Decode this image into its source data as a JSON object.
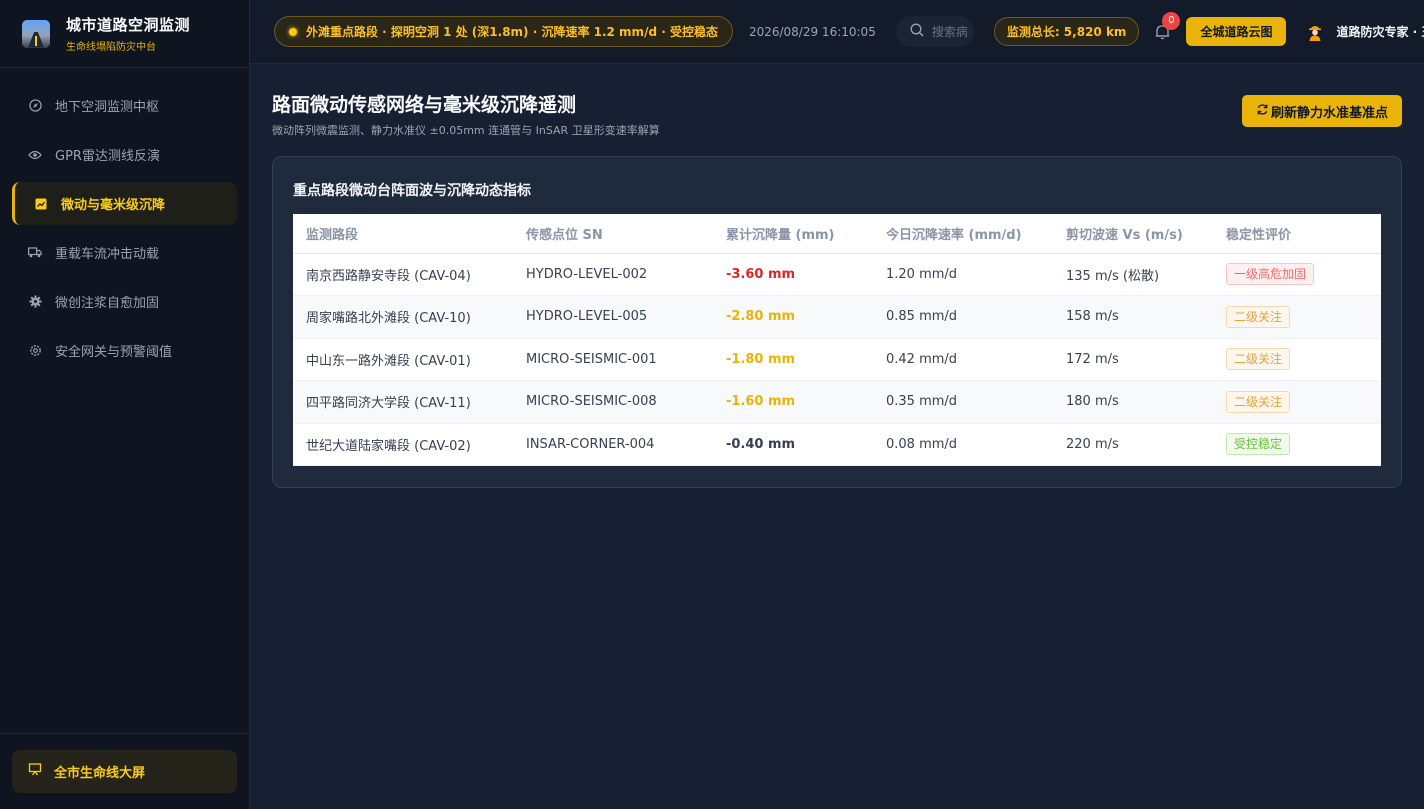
{
  "brand": {
    "title": "城市道路空洞监测",
    "subtitle": "生命线塌陷防灾中台"
  },
  "sidebar": {
    "items": [
      {
        "label": "地下空洞监测中枢",
        "icon": "compass-icon"
      },
      {
        "label": "GPR雷达测线反演",
        "icon": "eye-icon"
      },
      {
        "label": "微动与毫米级沉降",
        "icon": "chart-icon",
        "active": true
      },
      {
        "label": "重载车流冲击动载",
        "icon": "truck-icon"
      },
      {
        "label": "微创注浆自愈加固",
        "icon": "gear-icon"
      },
      {
        "label": "安全网关与预警阈值",
        "icon": "settings-icon"
      }
    ],
    "bottom_button": "全市生命线大屏"
  },
  "header": {
    "alert": "外滩重点路段 · 探明空洞 1 处 (深1.8m) · 沉降速率 1.2 mm/d · 受控稳态",
    "datetime": "2026/08/29 16:10:05",
    "search_placeholder": "搜索病",
    "length": "监测总长: 5,820 km",
    "notifications": "0",
    "map_button": "全城道路云图",
    "user": "道路防灾专家 · 王总工"
  },
  "page": {
    "title": "路面微动传感网络与毫米级沉降遥测",
    "subtitle": "微动阵列微震监测、静力水准仪 ±0.05mm 连通管与 InSAR 卫星形变速率解算",
    "refresh_button": "刷新静力水准基准点"
  },
  "card": {
    "title": "重点路段微动台阵面波与沉降动态指标",
    "columns": [
      "监测路段",
      "传感点位 SN",
      "累计沉降量 (mm)",
      "今日沉降速率 (mm/d)",
      "剪切波速 Vs (m/s)",
      "稳定性评价"
    ],
    "rows": [
      {
        "section": "南京西路静安寺段 (CAV-04)",
        "sn": "HYDRO-LEVEL-002",
        "settle": "-3.60 mm",
        "rate": "1.20 mm/d",
        "vs": "135 m/s (松散)",
        "eval": "一级高危加固"
      },
      {
        "section": "周家嘴路北外滩段 (CAV-10)",
        "sn": "HYDRO-LEVEL-005",
        "settle": "-2.80 mm",
        "rate": "0.85 mm/d",
        "vs": "158 m/s",
        "eval": "二级关注"
      },
      {
        "section": "中山东一路外滩段 (CAV-01)",
        "sn": "MICRO-SEISMIC-001",
        "settle": "-1.80 mm",
        "rate": "0.42 mm/d",
        "vs": "172 m/s",
        "eval": "二级关注"
      },
      {
        "section": "四平路同济大学段 (CAV-11)",
        "sn": "MICRO-SEISMIC-008",
        "settle": "-1.60 mm",
        "rate": "0.35 mm/d",
        "vs": "180 m/s",
        "eval": "二级关注"
      },
      {
        "section": "世纪大道陆家嘴段 (CAV-02)",
        "sn": "INSAR-CORNER-004",
        "settle": "-0.40 mm",
        "rate": "0.08 mm/d",
        "vs": "220 m/s",
        "eval": "受控稳定"
      }
    ]
  },
  "colors": {
    "accent": "#eab308",
    "danger": "#dc2626",
    "background": "#172033"
  }
}
